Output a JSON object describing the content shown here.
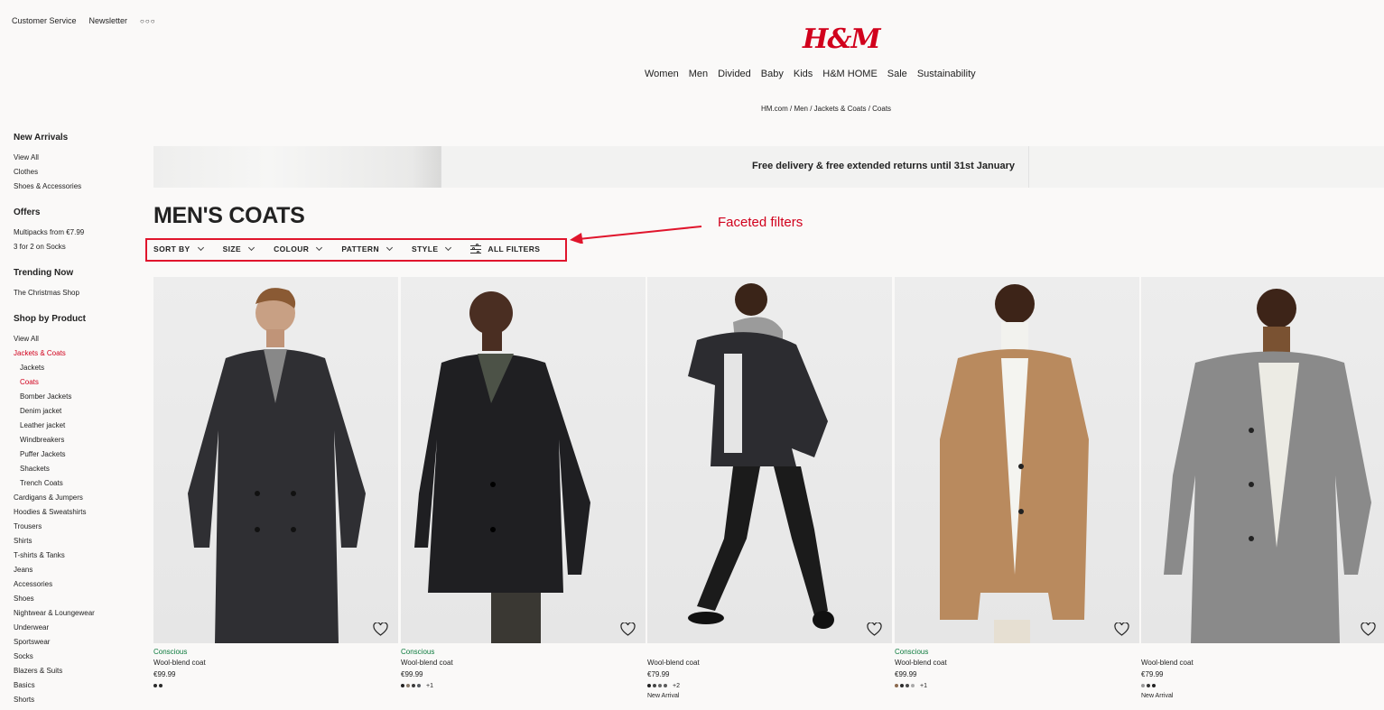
{
  "top_links": [
    "Customer Service",
    "Newsletter"
  ],
  "logo": "H&M",
  "main_nav": [
    "Women",
    "Men",
    "Divided",
    "Baby",
    "Kids",
    "H&M HOME",
    "Sale",
    "Sustainability"
  ],
  "breadcrumb": "HM.com / Men / Jackets & Coats / Coats",
  "sidebar": {
    "new_arrivals": {
      "title": "New Arrivals",
      "items": [
        "View All",
        "Clothes",
        "Shoes & Accessories"
      ]
    },
    "offers": {
      "title": "Offers",
      "items": [
        "Multipacks from €7.99",
        "3 for 2 on Socks"
      ]
    },
    "trending": {
      "title": "Trending Now",
      "items": [
        "The Christmas Shop"
      ]
    },
    "shop_by_product": {
      "title": "Shop by Product",
      "items": [
        "View All",
        "Jackets & Coats",
        "Jackets",
        "Coats",
        "Bomber Jackets",
        "Denim jacket",
        "Leather jacket",
        "Windbreakers",
        "Puffer Jackets",
        "Shackets",
        "Trench Coats",
        "Cardigans & Jumpers",
        "Hoodies & Sweatshirts",
        "Trousers",
        "Shirts",
        "T-shirts & Tanks",
        "Jeans",
        "Accessories",
        "Shoes",
        "Nightwear & Loungewear",
        "Underwear",
        "Sportswear",
        "Socks",
        "Blazers & Suits",
        "Basics",
        "Shorts"
      ]
    }
  },
  "banner": {
    "text": "Free delivery & free extended returns until 31st January"
  },
  "page_title": "MEN'S COATS",
  "filters": [
    "SORT BY",
    "SIZE",
    "COLOUR",
    "PATTERN",
    "STYLE"
  ],
  "all_filters": "ALL FILTERS",
  "annotation": "Faceted filters",
  "colors": {
    "accent": "#d1001c",
    "conscious": "#0c7a3d",
    "annotation": "#e0152c"
  },
  "products": [
    {
      "tag": "Conscious",
      "name": "Wool-blend coat",
      "price": "€99.99",
      "swatches": [
        "#2b2b2b",
        "#2b2b2b"
      ],
      "more": "",
      "badge": ""
    },
    {
      "tag": "Conscious",
      "name": "Wool-blend coat",
      "price": "€99.99",
      "swatches": [
        "#222222",
        "#8a7a6a",
        "#3b3b3b",
        "#555a60"
      ],
      "more": "+1",
      "badge": ""
    },
    {
      "tag": "",
      "name": "Wool-blend coat",
      "price": "€79.99",
      "swatches": [
        "#222222",
        "#444444",
        "#666666",
        "#5a5a5a"
      ],
      "more": "+2",
      "badge": "New Arrival"
    },
    {
      "tag": "Conscious",
      "name": "Wool-blend coat",
      "price": "€99.99",
      "swatches": [
        "#8c6a4e",
        "#2b2b2b",
        "#4a4a4a",
        "#aaaaaa"
      ],
      "more": "+1",
      "badge": ""
    },
    {
      "tag": "",
      "name": "Wool-blend coat",
      "price": "€79.99",
      "swatches": [
        "#999999",
        "#333333",
        "#222222"
      ],
      "more": "",
      "badge": "New Arrival"
    }
  ]
}
